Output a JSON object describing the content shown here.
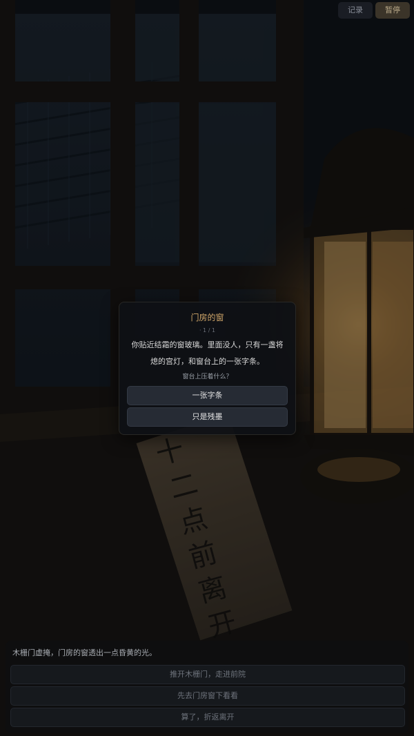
{
  "top_bar": {
    "log_label": "记录",
    "pause_label": "暂停"
  },
  "dialog": {
    "title": "门房的窗",
    "page": "· 1 / 1",
    "body_line1": "你贴近结霜的窗玻璃。里面没人，只有一盏将",
    "body_line2": "熄的宫灯，和窗台上的一张字条。",
    "question": "窗台上压着什么？",
    "choices": [
      "一张字条",
      "只是残墨"
    ]
  },
  "note_text": "十二点前离开",
  "bottom": {
    "narration": "木栅门虚掩，门房的窗透出一点昏黄的光。",
    "options": [
      "推开木栅门，走进前院",
      "先去门房窗下看看",
      "算了，折返离开"
    ]
  },
  "colors": {
    "accent_title": "#d2a86a",
    "lantern_glow": "#f0b860"
  }
}
